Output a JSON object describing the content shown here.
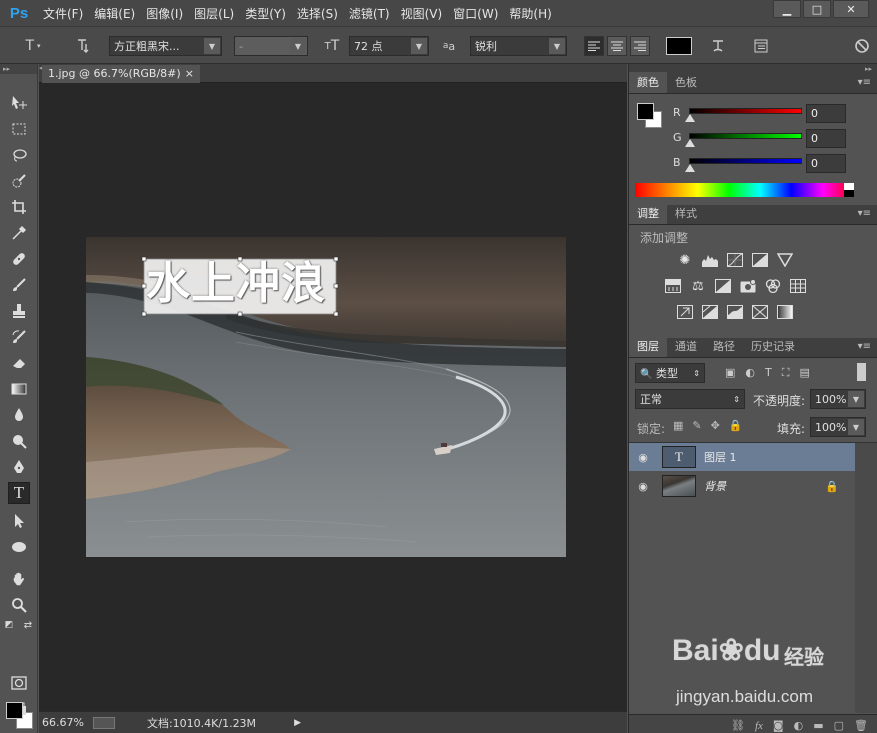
{
  "app": {
    "logo": "Ps"
  },
  "menu": [
    "文件(F)",
    "编辑(E)",
    "图像(I)",
    "图层(L)",
    "类型(Y)",
    "选择(S)",
    "滤镜(T)",
    "视图(V)",
    "窗口(W)",
    "帮助(H)"
  ],
  "window_buttons": {
    "minimize": "▁",
    "maximize": "□",
    "close": "✕"
  },
  "options": {
    "font_family": "方正粗黑宋...",
    "font_style": "-",
    "font_size": "72 点",
    "aa_label": "a",
    "antialias": "锐利"
  },
  "document": {
    "tab_title": "1.jpg @ 66.7%(RGB/8#)",
    "tab_close": "×",
    "canvas_text": "水上冲浪",
    "zoom": "66.67%",
    "doc_info": "文档:1010.4K/1.23M"
  },
  "color_panel": {
    "tabs": [
      "颜色",
      "色板"
    ],
    "channels": [
      {
        "label": "R",
        "value": "0",
        "gradient": "#ff0000"
      },
      {
        "label": "G",
        "value": "0",
        "gradient": "#00ff00"
      },
      {
        "label": "B",
        "value": "0",
        "gradient": "#0000ff"
      }
    ]
  },
  "adjust_panel": {
    "tabs": [
      "调整",
      "样式"
    ],
    "title": "添加调整"
  },
  "layers_panel": {
    "tabs": [
      "图层",
      "通道",
      "路径",
      "历史记录"
    ],
    "filter_label": "类型",
    "blend_mode": "正常",
    "opacity_label": "不透明度:",
    "opacity": "100%",
    "lock_label": "锁定:",
    "fill_label": "填充:",
    "fill": "100%",
    "layers": [
      {
        "name": "图层 1",
        "thumb": "T",
        "selected": true
      },
      {
        "name": "背景",
        "thumb": "",
        "selected": false
      }
    ]
  },
  "watermark": {
    "brand": "Bai",
    "brand2": "du",
    "suffix": "经验",
    "url": "jingyan.baidu.com"
  }
}
